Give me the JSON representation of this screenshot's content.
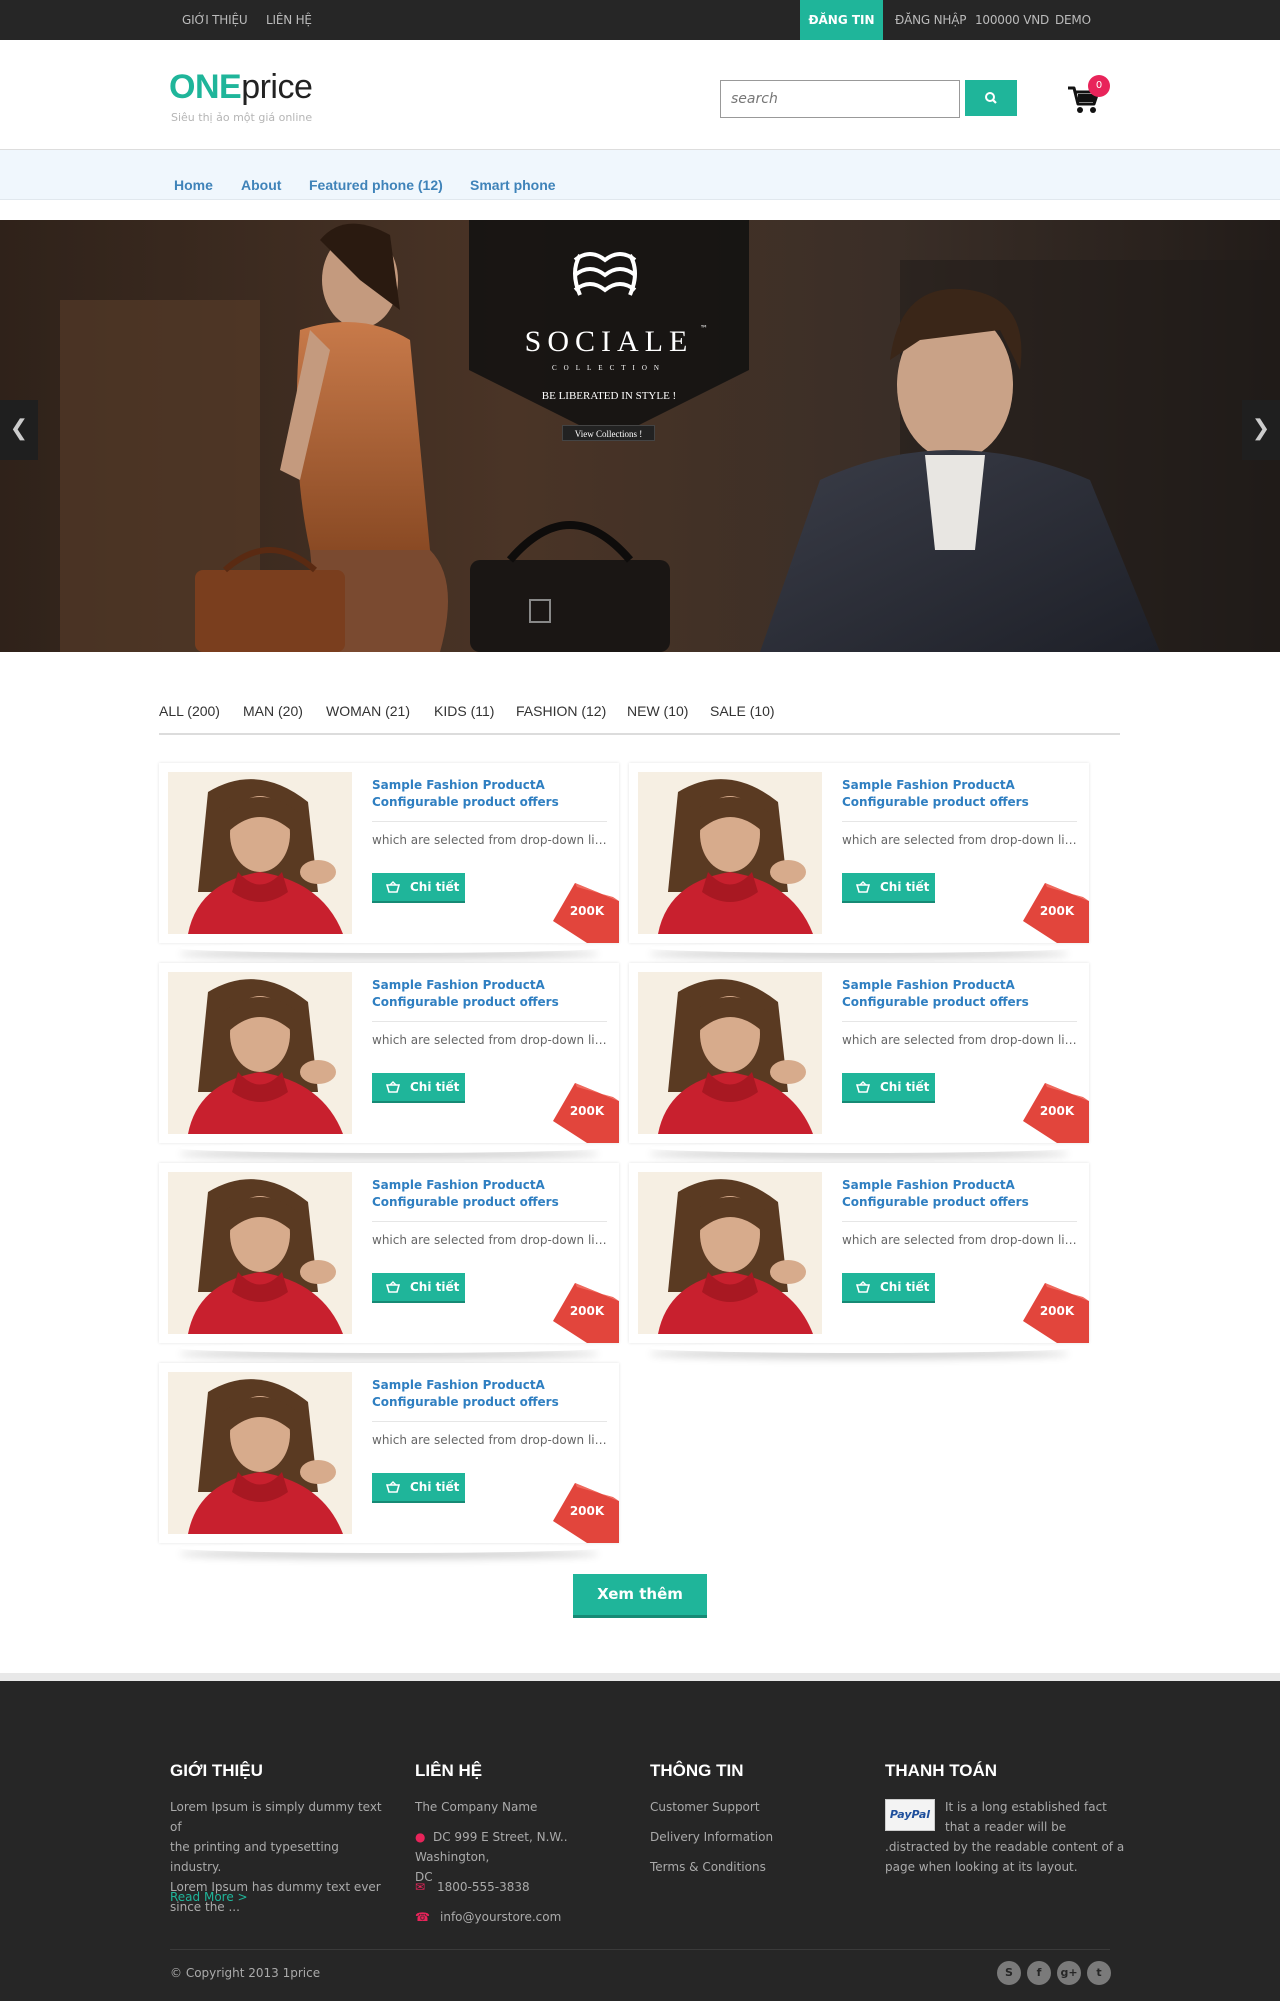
{
  "topbar": {
    "left_links": [
      "GIỚI THIỆU",
      "LIÊN HỆ"
    ],
    "post_button": "ĐĂNG TIN",
    "right_links": [
      "ĐĂNG NHẬP",
      "100000 VND",
      "DEMO"
    ]
  },
  "header": {
    "logo_one": "ONE",
    "logo_price": "price",
    "tagline": "Siêu thị ảo một giá online",
    "search_placeholder": "search",
    "cart_count": "0",
    "search_icon": "search-icon",
    "cart_icon": "shopping-cart-icon"
  },
  "nav": [
    "Home",
    "About",
    "Featured phone (12)",
    "Smart phone"
  ],
  "slider": {
    "brand": "SOCIALE",
    "trademark": "™",
    "collection": "COLLECTION",
    "slogan": "BE LIBERATED IN STYLE !",
    "cta": "View Collections !",
    "prev_icon": "chevron-left-icon",
    "next_icon": "chevron-right-icon",
    "slide_count": 4
  },
  "filters": [
    "ALL (200)",
    "MAN (20)",
    "WOMAN (21)",
    "KIDS (11)",
    "FASHION (12)",
    "NEW (10)",
    "SALE (10)"
  ],
  "products": [
    {
      "title": "Sample Fashion ProductA Configurable product offers",
      "desc": "which are selected from drop-down lists...",
      "button": "Chi tiết",
      "price": "200K"
    },
    {
      "title": "Sample Fashion ProductA Configurable product offers",
      "desc": "which are selected from drop-down lists...",
      "button": "Chi tiết",
      "price": "200K"
    },
    {
      "title": "Sample Fashion ProductA Configurable product offers",
      "desc": "which are selected from drop-down lists...",
      "button": "Chi tiết",
      "price": "200K"
    },
    {
      "title": "Sample Fashion ProductA Configurable product offers",
      "desc": "which are selected from drop-down lists...",
      "button": "Chi tiết",
      "price": "200K"
    },
    {
      "title": "Sample Fashion ProductA Configurable product offers",
      "desc": "which are selected from drop-down lists...",
      "button": "Chi tiết",
      "price": "200K"
    },
    {
      "title": "Sample Fashion ProductA Configurable product offers",
      "desc": "which are selected from drop-down lists...",
      "button": "Chi tiết",
      "price": "200K"
    },
    {
      "title": "Sample Fashion ProductA Configurable product offers",
      "desc": "which are selected from drop-down lists...",
      "button": "Chi tiết",
      "price": "200K"
    }
  ],
  "load_more": "Xem thêm",
  "footer": {
    "about": {
      "heading": "GIỚI THIỆU",
      "lines": [
        "Lorem Ipsum is simply dummy text of",
        "the printing and typesetting industry.",
        "Lorem Ipsum has dummy text ever",
        "since the ..."
      ],
      "read_more": "Read More  >"
    },
    "contact": {
      "heading": "LIÊN HỆ",
      "company": "The Company Name",
      "address": [
        "DC 999 E Street, N.W.. Washington,",
        "DC"
      ],
      "phone": "1800-555-3838",
      "email": "info@yourstore.com"
    },
    "info": {
      "heading": "THÔNG TIN",
      "links": [
        "Customer Support",
        "Delivery Information",
        "Terms & Conditions"
      ]
    },
    "payment": {
      "heading": "THANH TOÁN",
      "paypal": "PayPal",
      "first_lines": [
        "It is a long established fact",
        "that a reader will be"
      ],
      "more_lines": [
        ".distracted by the readable content of a",
        "page when looking at its layout."
      ]
    },
    "copyright": "© Copyright 2013 1price",
    "social_icons": [
      "skype-icon",
      "facebook-icon",
      "google-plus-icon",
      "twitter-icon"
    ]
  },
  "colors": {
    "accent": "#1fb59a",
    "link_blue": "#2f7fc1",
    "badge_red": "#e8245a",
    "price_red": "#e2453c",
    "dark": "#262626"
  }
}
